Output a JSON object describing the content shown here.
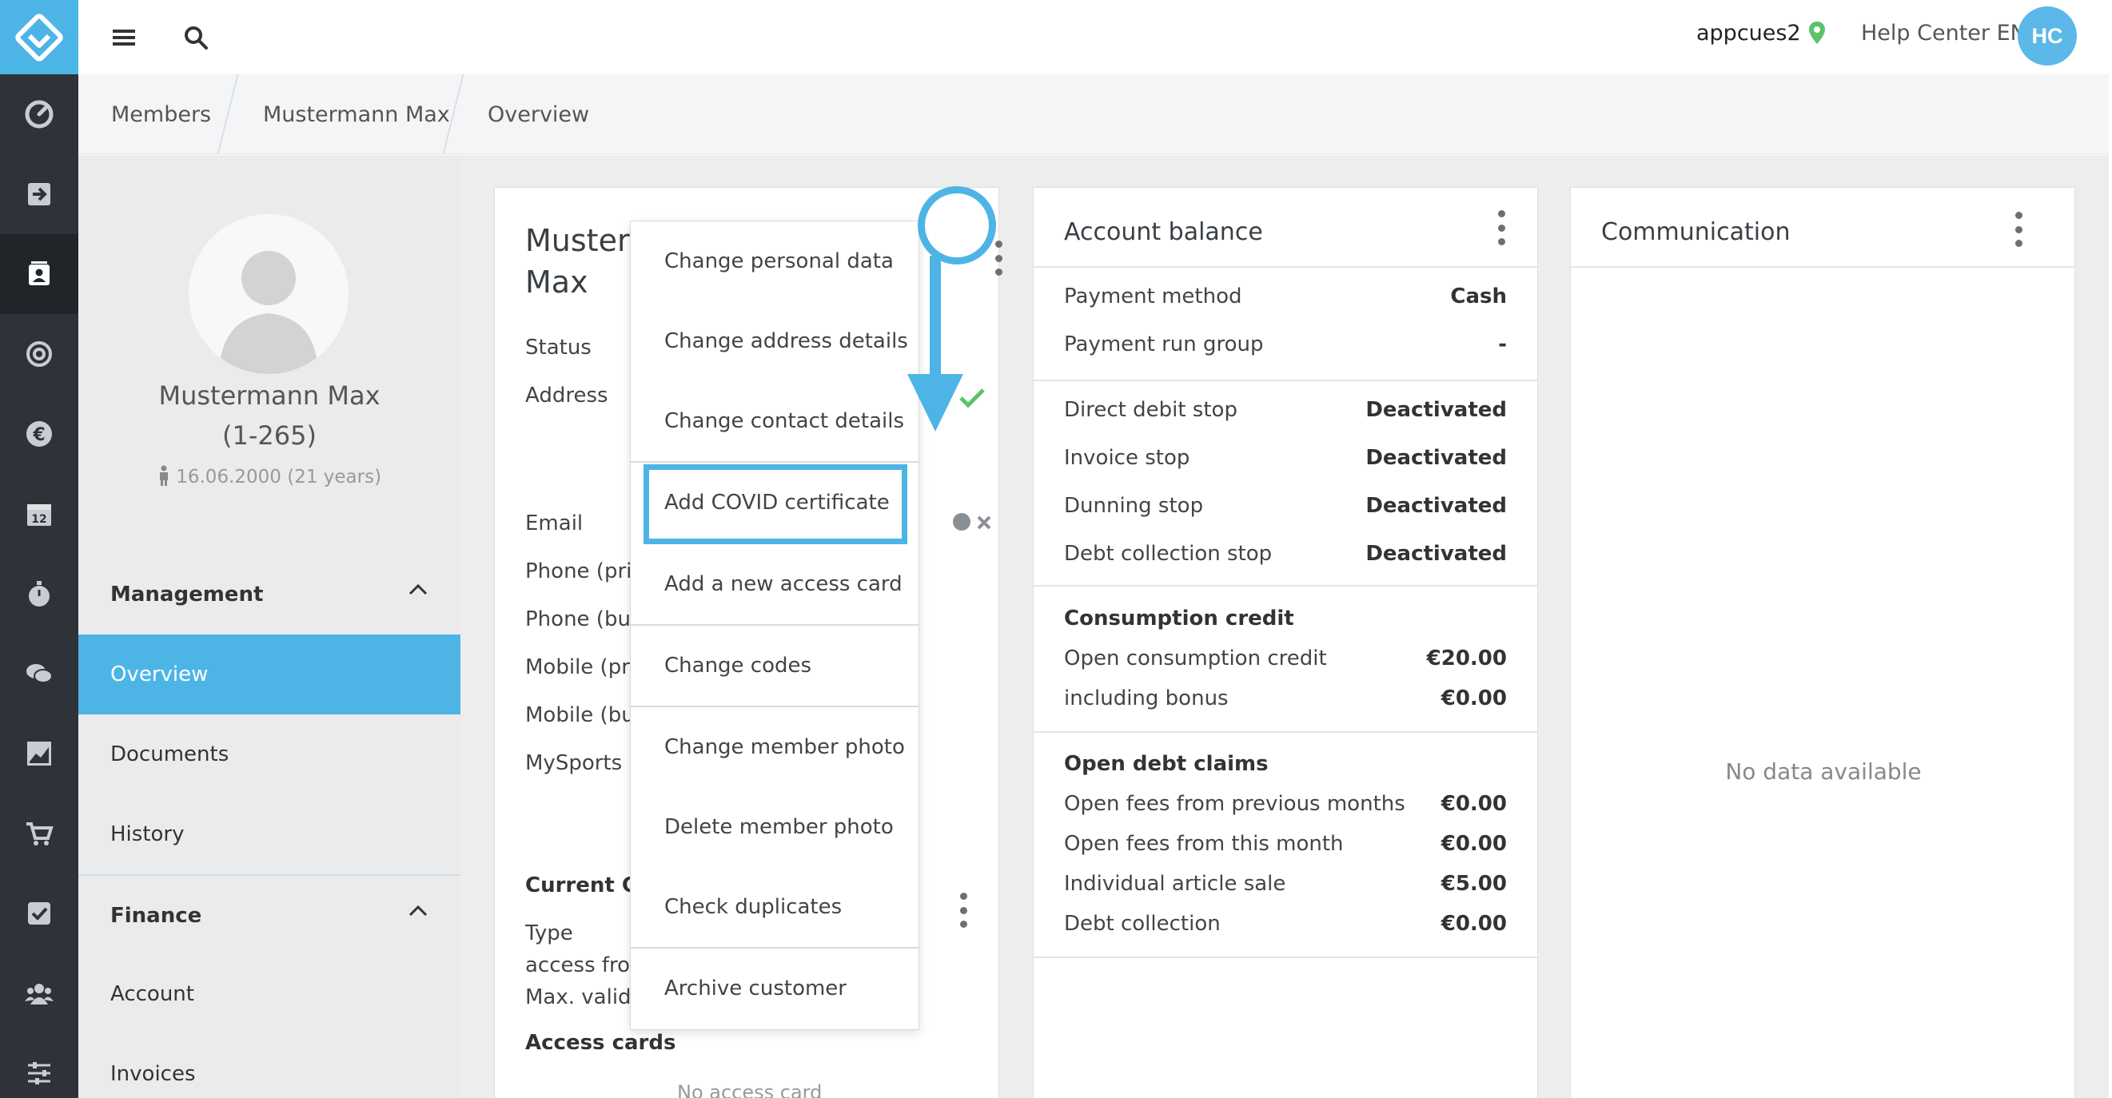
{
  "topbar": {
    "username": "appcues2",
    "help_center": "Help Center EN",
    "avatar_initials": "HC"
  },
  "breadcrumb": [
    "Members",
    "Mustermann Max",
    "Overview"
  ],
  "profile": {
    "name": "Mustermann Max",
    "member_id": "(1-265)",
    "dob": "16.06.2000 (21 years)"
  },
  "leftnav": {
    "management": {
      "title": "Management",
      "items": [
        "Overview",
        "Documents",
        "History"
      ]
    },
    "finance": {
      "title": "Finance",
      "items": [
        "Account",
        "Invoices"
      ]
    }
  },
  "member_card": {
    "title_line1": "Musterr",
    "title_line2": "Max",
    "labels": [
      "Status",
      "Address",
      "Email",
      "Phone (priv",
      "Phone (bus",
      "Mobile (priv",
      "Mobile (bus",
      "MySports"
    ],
    "current_section": "Current CO",
    "current_labels": [
      "Type",
      "access from",
      "Max. valid u"
    ],
    "access_cards_title": "Access cards",
    "no_access_card": "No access card"
  },
  "dropdown_menu": {
    "items": [
      "Change personal data",
      "Change address details",
      "Change contact details",
      "Add COVID certificate",
      "Add a new access card",
      "Change codes",
      "Change member photo",
      "Delete member photo",
      "Check duplicates",
      "Archive customer"
    ]
  },
  "account_balance": {
    "title": "Account balance",
    "payment": [
      {
        "label": "Payment method",
        "value": "Cash"
      },
      {
        "label": "Payment run group",
        "value": "-"
      }
    ],
    "stops": [
      {
        "label": "Direct debit stop",
        "value": "Deactivated"
      },
      {
        "label": "Invoice stop",
        "value": "Deactivated"
      },
      {
        "label": "Dunning stop",
        "value": "Deactivated"
      },
      {
        "label": "Debt collection stop",
        "value": "Deactivated"
      }
    ],
    "consumption": {
      "title": "Consumption credit",
      "rows": [
        {
          "label": "Open consumption credit",
          "value": "€20.00"
        },
        {
          "label": "including bonus",
          "value": "€0.00"
        }
      ]
    },
    "debt": {
      "title": "Open debt claims",
      "rows": [
        {
          "label": "Open fees from previous months",
          "value": "€0.00"
        },
        {
          "label": "Open fees from this month",
          "value": "€0.00"
        },
        {
          "label": "Individual article sale",
          "value": "€5.00"
        },
        {
          "label": "Debt collection",
          "value": "€0.00"
        }
      ]
    }
  },
  "communication": {
    "title": "Communication",
    "empty": "No data available"
  },
  "colors": {
    "accent": "#4db5e6",
    "rail": "#2d3339",
    "check": "#5cc26b"
  }
}
